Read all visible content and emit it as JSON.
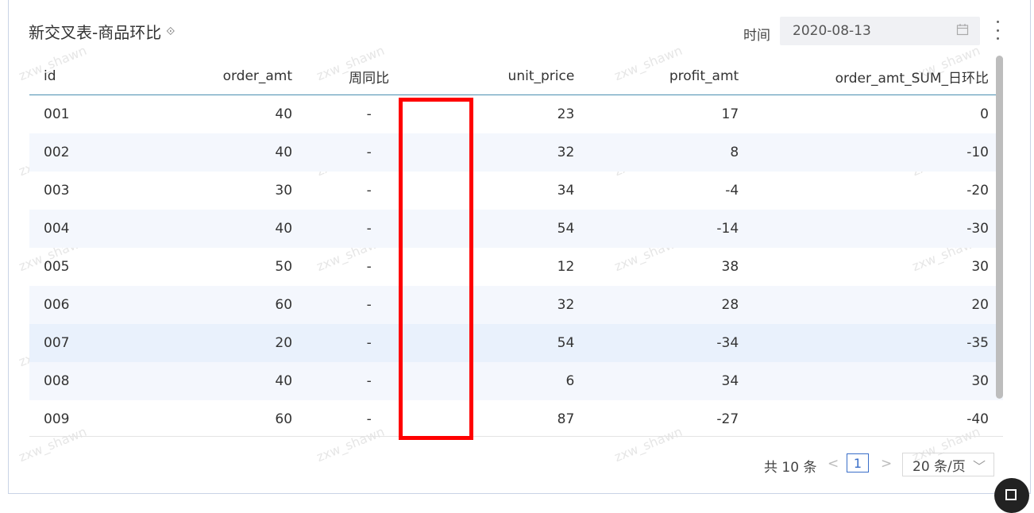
{
  "header": {
    "title": "新交叉表-商品环比",
    "time_label": "时间",
    "date_value": "2020-08-13"
  },
  "table": {
    "columns": [
      "id",
      "order_amt",
      "周同比",
      "unit_price",
      "profit_amt",
      "order_amt_SUM_日环比"
    ],
    "rows": [
      [
        "001",
        "40",
        "-",
        "23",
        "17",
        "0"
      ],
      [
        "002",
        "40",
        "-",
        "32",
        "8",
        "-10"
      ],
      [
        "003",
        "30",
        "-",
        "34",
        "-4",
        "-20"
      ],
      [
        "004",
        "40",
        "-",
        "54",
        "-14",
        "-30"
      ],
      [
        "005",
        "50",
        "-",
        "12",
        "38",
        "30"
      ],
      [
        "006",
        "60",
        "-",
        "32",
        "28",
        "20"
      ],
      [
        "007",
        "20",
        "-",
        "54",
        "-34",
        "-35"
      ],
      [
        "008",
        "40",
        "-",
        "6",
        "34",
        "30"
      ],
      [
        "009",
        "60",
        "-",
        "87",
        "-27",
        "-40"
      ]
    ]
  },
  "pagination": {
    "total_text": "共 10 条",
    "prev": "<",
    "current_page": "1",
    "next": ">",
    "page_size": "20 条/页"
  },
  "watermark": "zxw_shawn",
  "colors": {
    "highlight_box": "#ff0000",
    "header_underline": "#4a8fb0",
    "active_page": "#3a6ec8",
    "row_stripe": "#f4f7fd"
  }
}
